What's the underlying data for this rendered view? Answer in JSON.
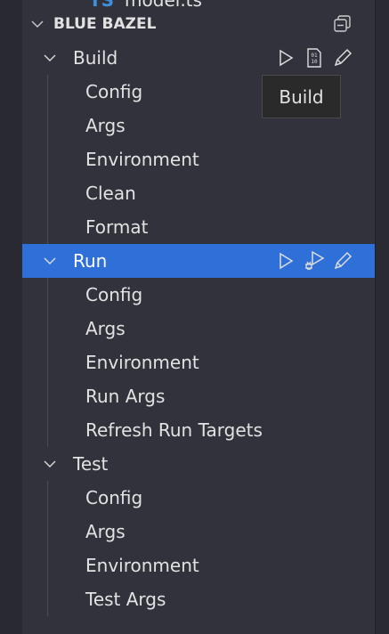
{
  "above_item": {
    "badge": "TS",
    "label": "model.ts"
  },
  "section": {
    "title": "BLUE BAZEL",
    "collapse_icon": "collapse-all-icon"
  },
  "groups": [
    {
      "label": "Build",
      "children": [
        "Config",
        "Args",
        "Environment",
        "Clean",
        "Format"
      ],
      "actions": [
        "play-icon",
        "binary-file-icon",
        "pencil-icon"
      ]
    },
    {
      "label": "Run",
      "selected": true,
      "children": [
        "Config",
        "Args",
        "Environment",
        "Run Args",
        "Refresh Run Targets"
      ],
      "actions": [
        "play-icon",
        "debug-play-icon",
        "pencil-icon"
      ]
    },
    {
      "label": "Test",
      "children": [
        "Config",
        "Args",
        "Environment",
        "Test Args"
      ]
    }
  ],
  "tooltip": "Build",
  "colors": {
    "selection": "#2f6fd8",
    "panel": "#31323b",
    "ts_badge": "#3d8fe0"
  }
}
